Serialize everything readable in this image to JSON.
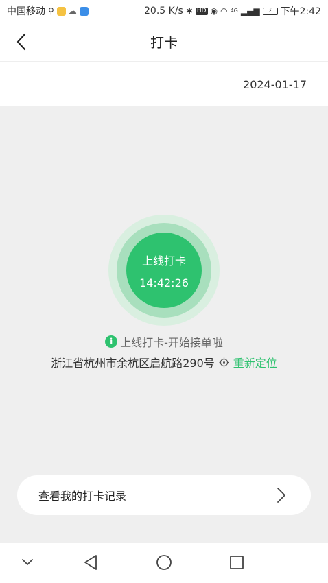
{
  "status_bar": {
    "carrier": "中国移动",
    "speed": "20.5 K/s",
    "network": "4G",
    "time": "下午2:42"
  },
  "nav": {
    "title": "打卡"
  },
  "date": "2024-01-17",
  "punch": {
    "label": "上线打卡",
    "time": "14:42:26"
  },
  "tip": {
    "text": "上线打卡-开始接单啦"
  },
  "location": {
    "address": "浙江省杭州市余杭区启航路290号",
    "relocate_label": "重新定位"
  },
  "records": {
    "label": "查看我的打卡记录"
  },
  "colors": {
    "accent": "#2ec26f",
    "ring_outer": "#d9efe0",
    "ring_mid": "#a8dfbd"
  }
}
